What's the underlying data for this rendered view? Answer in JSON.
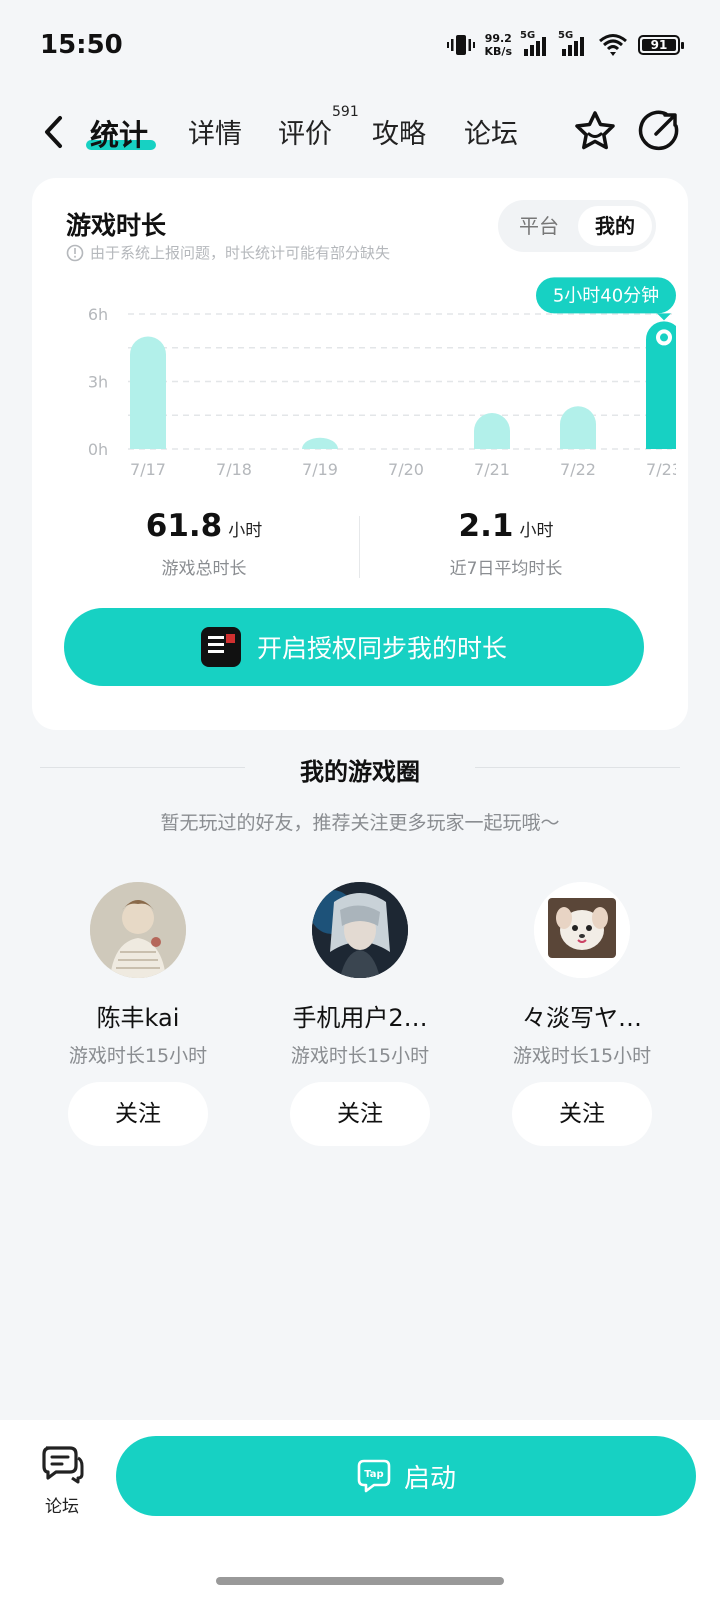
{
  "status_bar": {
    "time": "15:50",
    "net_speed_value": "99.2",
    "net_speed_unit": "KB/s",
    "sim1_label": "5G",
    "sim2_label": "5G",
    "battery": "91",
    "icons": [
      "vibrate-icon",
      "signal-icon",
      "wifi-icon",
      "battery-icon"
    ]
  },
  "nav": {
    "tabs": [
      {
        "label": "统计",
        "active": true
      },
      {
        "label": "详情",
        "active": false
      },
      {
        "label": "评价",
        "active": false,
        "badge": "591"
      },
      {
        "label": "攻略",
        "active": false
      },
      {
        "label": "论坛",
        "active": false
      }
    ],
    "icons": [
      "back-icon",
      "star-icon",
      "share-icon"
    ]
  },
  "stats_card": {
    "title": "游戏时长",
    "notice": "由于系统上报问题，时长统计可能有部分缺失",
    "segment": {
      "options": [
        "平台",
        "我的"
      ],
      "selected": "我的"
    },
    "total_value": "61.8",
    "total_unit": "小时",
    "total_label": "游戏总时长",
    "avg_value": "2.1",
    "avg_unit": "小时",
    "avg_label": "近7日平均时长",
    "sync_button_label": "开启授权同步我的时长"
  },
  "chart_data": {
    "type": "bar",
    "categories": [
      "7/17",
      "7/18",
      "7/19",
      "7/20",
      "7/21",
      "7/22",
      "7/23"
    ],
    "values": [
      5.0,
      0,
      0.5,
      0,
      1.6,
      1.9,
      5.67
    ],
    "y_ticks": [
      "0h",
      "3h",
      "6h"
    ],
    "ylim": [
      0,
      6
    ],
    "unit": "h",
    "highlighted_index": 6,
    "tooltip": "5小时40分钟",
    "grid": true,
    "colors": {
      "bar": "#b2f0ea",
      "highlight": "#17d1c3"
    }
  },
  "game_circle": {
    "title": "我的游戏圈",
    "subtitle": "暂无玩过的好友，推荐关注更多玩家一起玩哦～",
    "friends": [
      {
        "name": "陈丰kai",
        "playtime": "游戏时长15小时",
        "follow_label": "关注"
      },
      {
        "name": "手机用户2…",
        "playtime": "游戏时长15小时",
        "follow_label": "关注"
      },
      {
        "name": "々淡写ヤ…",
        "playtime": "游戏时长15小时",
        "follow_label": "关注"
      }
    ]
  },
  "bottom_bar": {
    "forum_label": "论坛",
    "launch_label": "启动",
    "launch_icon": "tap-icon"
  },
  "colors": {
    "accent": "#17d1c3",
    "background": "#f4f6f8",
    "card": "#ffffff"
  }
}
